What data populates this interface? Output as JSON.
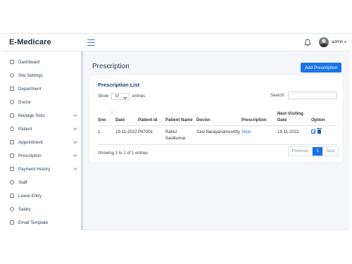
{
  "brand": "E-Medicare",
  "header": {
    "user": "admin"
  },
  "sidebar": {
    "items": [
      {
        "label": "Dashboard",
        "icon": "dashboard-icon",
        "has_submenu": false
      },
      {
        "label": "Site Settings",
        "icon": "settings-icon",
        "has_submenu": false
      },
      {
        "label": "Department",
        "icon": "department-icon",
        "has_submenu": false
      },
      {
        "label": "Doctor",
        "icon": "doctor-icon",
        "has_submenu": false
      },
      {
        "label": "Manage Slots",
        "icon": "slots-icon",
        "has_submenu": true
      },
      {
        "label": "Patient",
        "icon": "patient-icon",
        "has_submenu": true
      },
      {
        "label": "Appointment",
        "icon": "appointment-icon",
        "has_submenu": true
      },
      {
        "label": "Prescription",
        "icon": "prescription-icon",
        "has_submenu": true
      },
      {
        "label": "Payment History",
        "icon": "payment-icon",
        "has_submenu": true
      },
      {
        "label": "Staff",
        "icon": "staff-icon",
        "has_submenu": false
      },
      {
        "label": "Leave Entry",
        "icon": "leave-icon",
        "has_submenu": false
      },
      {
        "label": "Salary",
        "icon": "salary-icon",
        "has_submenu": false
      },
      {
        "label": "Email Template",
        "icon": "email-icon",
        "has_submenu": false
      }
    ]
  },
  "main": {
    "page_title": "Prescription",
    "add_button": "Add Prescription",
    "card_title": "Prescription List",
    "show_label": "Show",
    "page_size": "10",
    "entries_label": "entries",
    "search_label": "Search:",
    "search_value": "",
    "table": {
      "columns": [
        "Sno",
        "Date",
        "Patient Id",
        "Patient Name",
        "Doctor",
        "Prescription",
        "Next Visiting Date",
        "Option"
      ],
      "rows": [
        {
          "sno": "1",
          "date": "19-11-2022",
          "patient_id": "PAT001",
          "patient_name": "Rahul Sasikumar",
          "doctor": "Sasi Narayanamoorthy",
          "prescription": "View",
          "next_visit": "19-11-2022"
        }
      ]
    },
    "info": "Showing 1 to 1 of 1 entries",
    "pagination": {
      "previous": "Previous",
      "current": "1",
      "next": "Next"
    }
  },
  "colors": {
    "accent": "#1a73e8",
    "brand_text": "#1f2d3d",
    "card_title": "#1f3b70"
  }
}
